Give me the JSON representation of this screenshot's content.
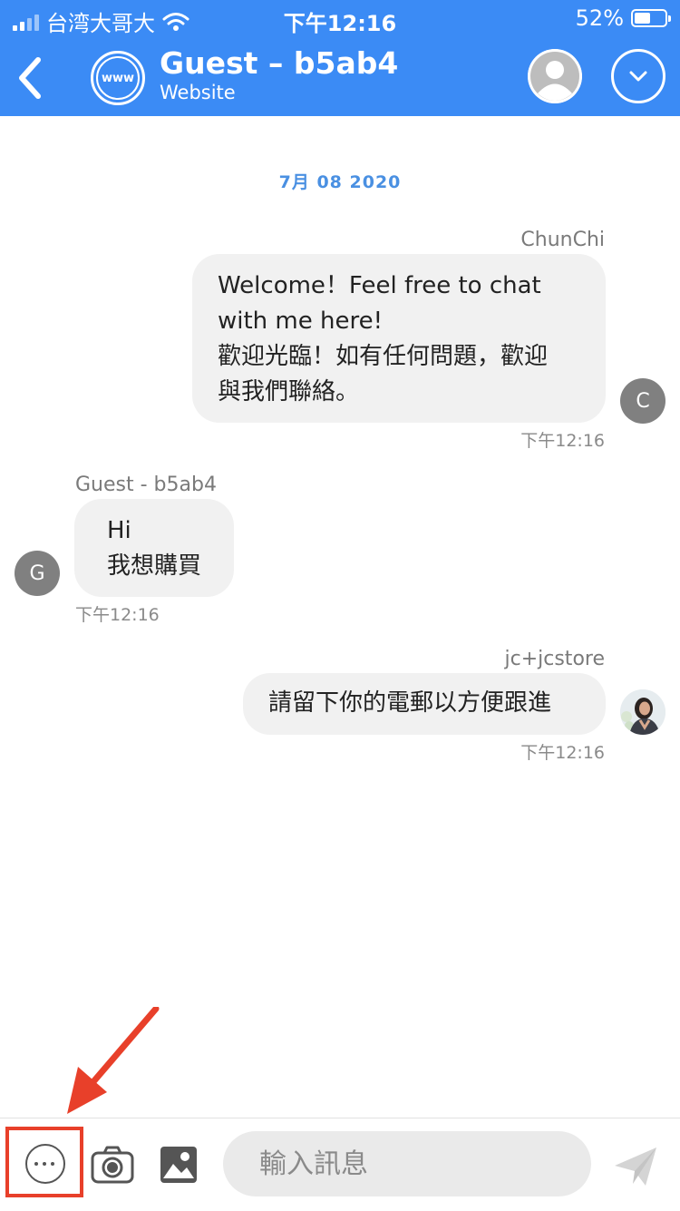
{
  "status_bar": {
    "carrier": "台湾大哥大",
    "time": "下午12:16",
    "battery": "52%"
  },
  "header": {
    "avatar_text": "www",
    "title": "Guest – b5ab4",
    "subtitle": "Website"
  },
  "chat": {
    "date_divider": "7月 08 2020",
    "messages": [
      {
        "sender": "ChunChi",
        "text_line1": "Welcome！Feel free to chat",
        "text_line2": "with me here!",
        "text_line3": "歡迎光臨！如有任何問題，歡迎",
        "text_line4": "與我們聯絡。",
        "time": "下午12:16",
        "avatar_letter": "C"
      },
      {
        "sender": "Guest - b5ab4",
        "text_line1": "Hi",
        "text_line2": "我想購買",
        "time": "下午12:16",
        "avatar_letter": "G"
      },
      {
        "sender": "jc+jcstore",
        "text_line1": "請留下你的電郵以方便跟進",
        "time": "下午12:16"
      }
    ]
  },
  "input_bar": {
    "placeholder": "輸入訊息"
  },
  "colors": {
    "header": "#3b8bf5",
    "date_text": "#4a90e2",
    "bubble": "#f1f1f1",
    "annotation": "#e8402a"
  }
}
